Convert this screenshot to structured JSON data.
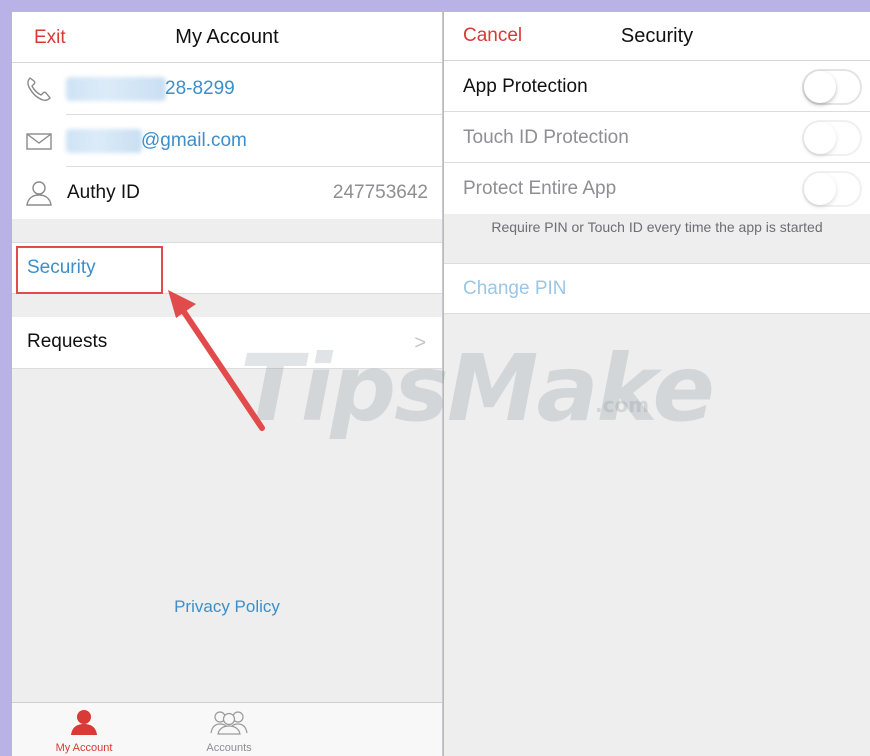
{
  "left_pane": {
    "navbar": {
      "left_link": "Exit",
      "title": "My Account"
    },
    "phone_row": {
      "icon": "phone-icon",
      "value_suffix": "28-8299"
    },
    "email_row": {
      "icon": "envelope-icon",
      "value_suffix": "@gmail.com"
    },
    "authy_row": {
      "icon": "user-icon",
      "label": "Authy ID",
      "value": "247753642"
    },
    "security_row": {
      "label": "Security"
    },
    "requests_row": {
      "label": "Requests",
      "chevron": ">"
    },
    "privacy_link": "Privacy Policy",
    "tabbar": {
      "tabs": [
        {
          "label": "My Account",
          "icon": "person-icon",
          "active": true
        },
        {
          "label": "Accounts",
          "icon": "group-icon",
          "active": false
        }
      ]
    }
  },
  "right_pane": {
    "navbar": {
      "left_link": "Cancel",
      "title": "Security"
    },
    "toggles": [
      {
        "label": "App Protection",
        "on": false,
        "enabled": true
      },
      {
        "label": "Touch ID Protection",
        "on": false,
        "enabled": false
      },
      {
        "label": "Protect Entire App",
        "on": false,
        "enabled": false
      }
    ],
    "footnote": "Require PIN or Touch ID every time the app is started",
    "change_pin": "Change PIN"
  },
  "watermark": {
    "main": "TipsMake",
    "suffix": ".com"
  },
  "colors": {
    "accent_red": "#d83a35",
    "link_blue": "#3d8ec9",
    "disabled_blue": "#9cc6e4",
    "annotation_red": "#e14b4b"
  }
}
